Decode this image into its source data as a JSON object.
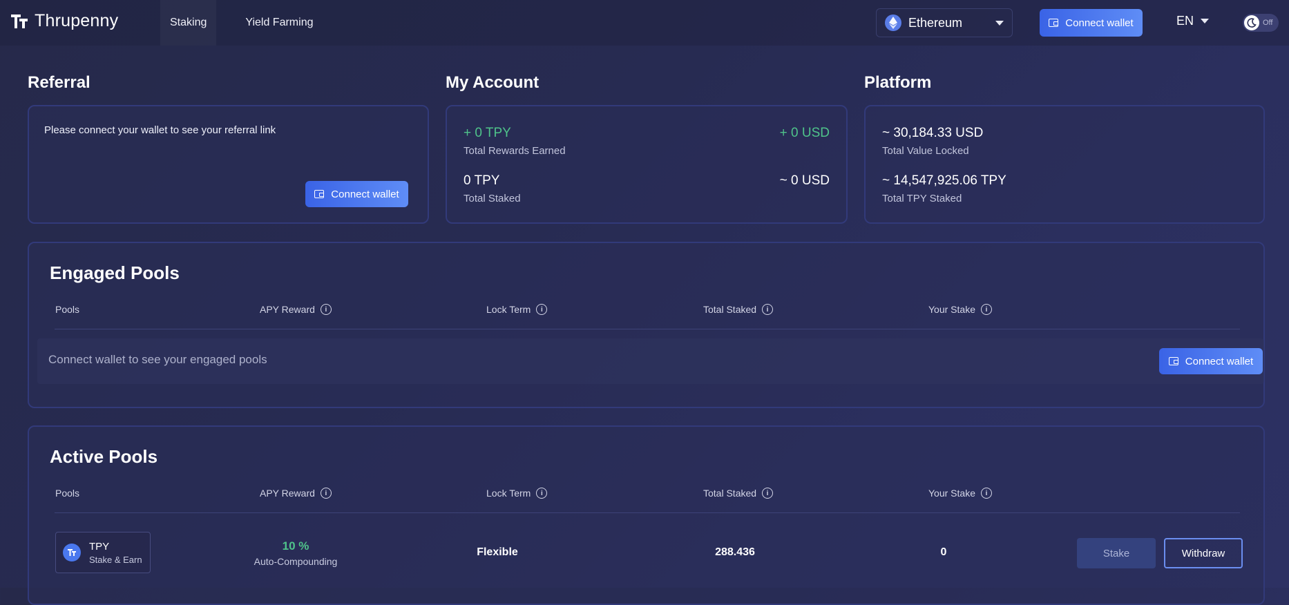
{
  "header": {
    "logo_text": "Thrupenny",
    "nav": [
      {
        "label": "Staking",
        "active": true
      },
      {
        "label": "Yield Farming",
        "active": false
      }
    ],
    "network": "Ethereum",
    "connect_label": "Connect wallet",
    "language": "EN",
    "theme_toggle_label": "Off"
  },
  "referral": {
    "title": "Referral",
    "message": "Please connect your wallet to see your referral link",
    "connect_label": "Connect wallet"
  },
  "account": {
    "title": "My Account",
    "rewards_tpy": "+ 0 TPY",
    "rewards_usd": "+ 0 USD",
    "rewards_label": "Total Rewards Earned",
    "staked_tpy": "0 TPY",
    "staked_usd": "~ 0 USD",
    "staked_label": "Total Staked"
  },
  "platform": {
    "title": "Platform",
    "tvl": "~ 30,184.33 USD",
    "tvl_label": "Total Value Locked",
    "tpy_staked": "~ 14,547,925.06 TPY",
    "tpy_staked_label": "Total TPY Staked"
  },
  "columns": {
    "pools": "Pools",
    "apy": "APY Reward",
    "lock": "Lock Term",
    "total": "Total Staked",
    "your": "Your Stake"
  },
  "engaged": {
    "title": "Engaged Pools",
    "message": "Connect wallet to see your engaged pools",
    "connect_label": "Connect wallet"
  },
  "active": {
    "title": "Active Pools",
    "pool": {
      "name": "TPY",
      "subtitle": "Stake & Earn",
      "apy": "10 %",
      "apy_sub": "Auto-Compounding",
      "lock": "Flexible",
      "total_staked": "288.436",
      "your_stake": "0",
      "stake_label": "Stake",
      "withdraw_label": "Withdraw"
    }
  },
  "colors": {
    "accent": "#3a63e6",
    "positive": "#4fc38a",
    "card_border": "#323a7a"
  }
}
